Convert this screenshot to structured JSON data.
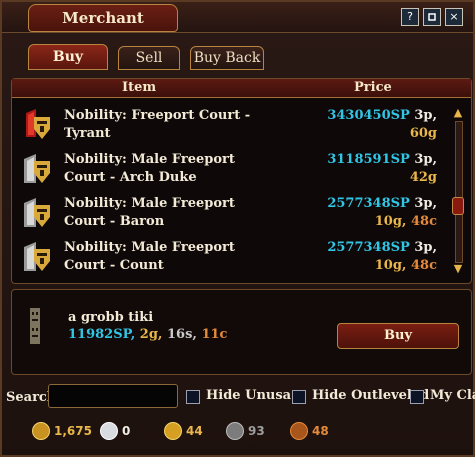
{
  "window": {
    "title": "Merchant"
  },
  "controls": {
    "help": "?",
    "restore": "",
    "close": "×"
  },
  "tabs": [
    {
      "label": "Buy",
      "active": true
    },
    {
      "label": "Sell",
      "active": false
    },
    {
      "label": "Buy Back",
      "active": false
    }
  ],
  "list": {
    "headers": {
      "item": "Item",
      "price": "Price"
    },
    "rows": [
      {
        "name": "Nobility: Freeport Court - Tyrant",
        "price_sp": "3430450SP",
        "price_p": "3p,",
        "price_g": "60g",
        "price_c": "",
        "icon": "red-winged-mask-icon"
      },
      {
        "name": "Nobility: Male Freeport Court - Arch Duke",
        "price_sp": "3118591SP",
        "price_p": "3p,",
        "price_g": "42g",
        "price_c": "",
        "icon": "grey-winged-mask-icon"
      },
      {
        "name": "Nobility: Male Freeport Court - Baron",
        "price_sp": "2577348SP",
        "price_p": "3p,",
        "price_g": "10g,",
        "price_c": "48c",
        "icon": "grey-winged-mask-icon"
      },
      {
        "name": "Nobility: Male Freeport Court - Count",
        "price_sp": "2577348SP",
        "price_p": "3p,",
        "price_g": "10g,",
        "price_c": "48c",
        "icon": "grey-winged-mask-icon"
      }
    ]
  },
  "detail": {
    "name": "a grobb tiki",
    "price_sp": "11982SP,",
    "price_g": "2g,",
    "price_s": "16s,",
    "price_c": "11c",
    "buy_label": "Buy",
    "icon": "tiki-totem-icon"
  },
  "filter": {
    "search_label": "Search",
    "search_value": "",
    "checkboxes": [
      {
        "label": "Hide Unusa...",
        "checked": false
      },
      {
        "label": "Hide Outleveled",
        "checked": false
      },
      {
        "label": "My Cla",
        "checked": false
      }
    ]
  },
  "currency": [
    {
      "icon": "status-points-icon",
      "value": "1,675",
      "color": "#e9b74a"
    },
    {
      "icon": "platinum-coin-icon",
      "value": "0",
      "color": "#f0ede5"
    },
    {
      "icon": "gold-coin-icon",
      "value": "44",
      "color": "#e9b74a"
    },
    {
      "icon": "silver-coin-icon",
      "value": "93",
      "color": "#9e9e9e"
    },
    {
      "icon": "copper-coin-icon",
      "value": "48",
      "color": "#e58a3a"
    }
  ]
}
